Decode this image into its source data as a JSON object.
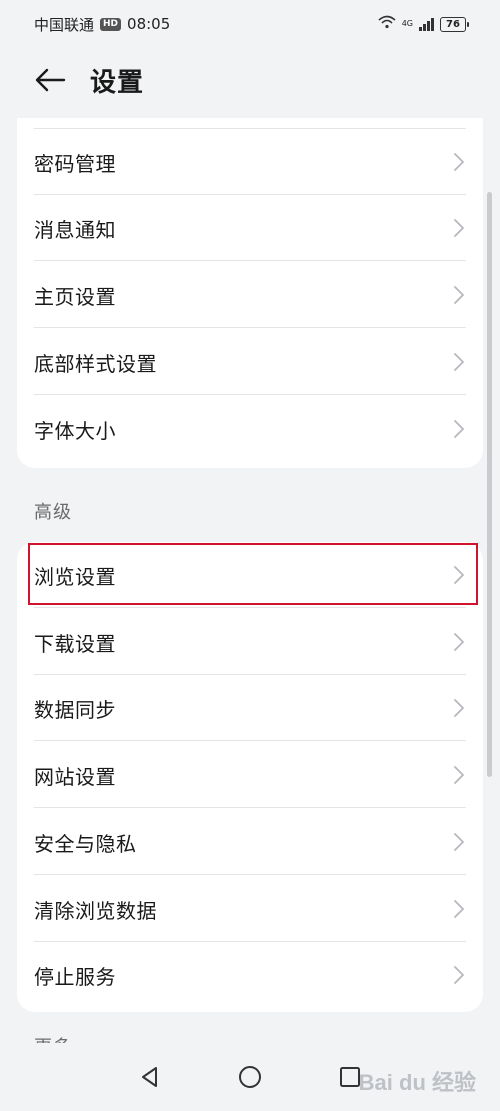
{
  "status_bar": {
    "carrier": "中国联通",
    "hd_badge": "HD",
    "time": "08:05",
    "network": "4G",
    "battery": "76"
  },
  "header": {
    "title": "设置",
    "back_icon": "back-arrow-icon"
  },
  "group_general": {
    "items": [
      {
        "label": "密码管理"
      },
      {
        "label": "消息通知"
      },
      {
        "label": "主页设置"
      },
      {
        "label": "底部样式设置"
      },
      {
        "label": "字体大小"
      }
    ]
  },
  "group_advanced": {
    "title": "高级",
    "items": [
      {
        "label": "浏览设置"
      },
      {
        "label": "下载设置"
      },
      {
        "label": "数据同步"
      },
      {
        "label": "网站设置"
      },
      {
        "label": "安全与隐私"
      },
      {
        "label": "清除浏览数据"
      },
      {
        "label": "停止服务"
      }
    ]
  },
  "group_more": {
    "title": "更多"
  },
  "watermark": "Bai du 经验",
  "colors": {
    "background": "#f1f3f5",
    "card": "#ffffff",
    "highlight": "#d0142c",
    "chevron": "#b5b8bd"
  }
}
